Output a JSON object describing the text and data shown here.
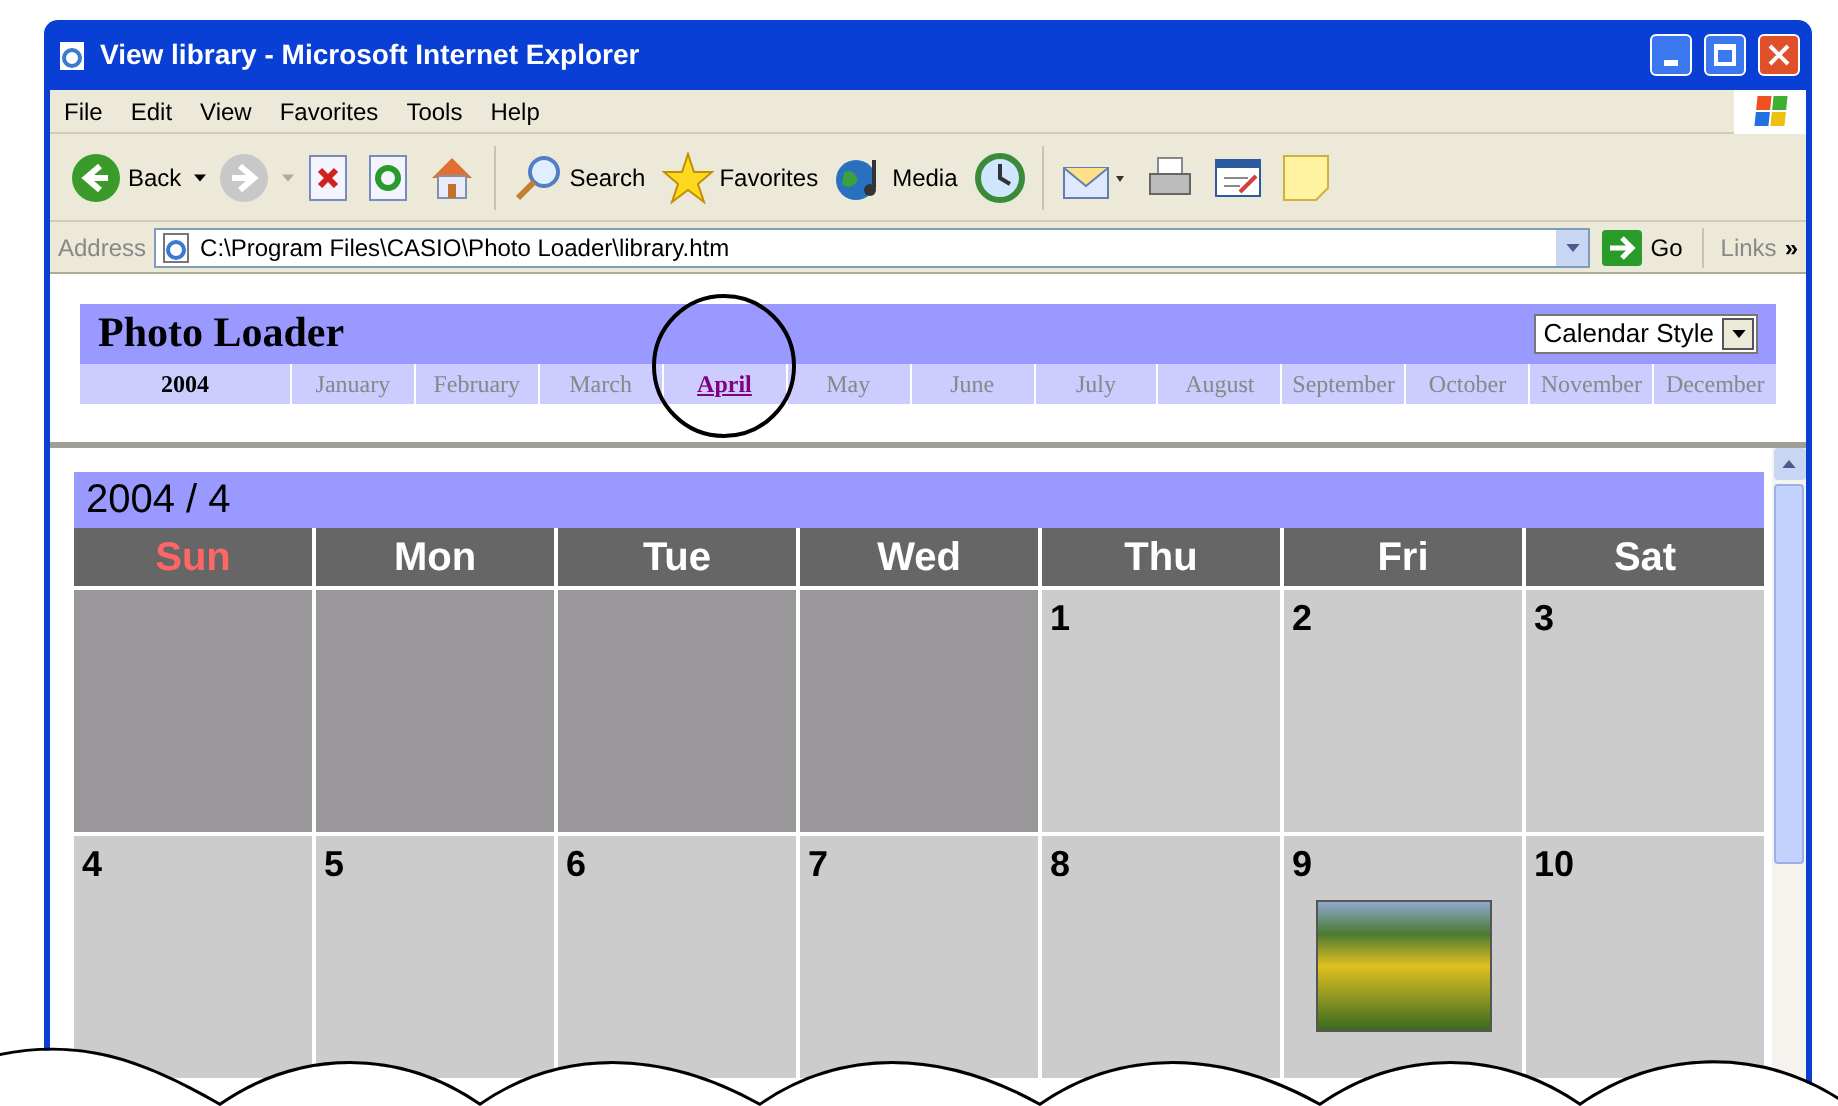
{
  "window": {
    "title": "View library - Microsoft Internet Explorer"
  },
  "menu": [
    "File",
    "Edit",
    "View",
    "Favorites",
    "Tools",
    "Help"
  ],
  "toolbar": [
    {
      "kind": "back",
      "label": "Back"
    },
    {
      "kind": "forward"
    },
    {
      "kind": "stop"
    },
    {
      "kind": "refresh"
    },
    {
      "kind": "home"
    },
    {
      "kind": "search",
      "label": "Search"
    },
    {
      "kind": "favorites",
      "label": "Favorites"
    },
    {
      "kind": "media",
      "label": "Media"
    },
    {
      "kind": "history"
    },
    {
      "kind": "mail"
    },
    {
      "kind": "print"
    },
    {
      "kind": "edit"
    },
    {
      "kind": "note"
    }
  ],
  "address_bar": {
    "label": "Address",
    "value": "C:\\Program Files\\CASIO\\Photo Loader\\library.htm",
    "go": "Go",
    "links": "Links",
    "more": "»"
  },
  "header": {
    "title": "Photo Loader",
    "style_select": "Calendar Style",
    "year": "2004",
    "months": [
      {
        "label": "January",
        "selected": false
      },
      {
        "label": "February",
        "selected": false
      },
      {
        "label": "March",
        "selected": false
      },
      {
        "label": "April",
        "selected": true
      },
      {
        "label": "May",
        "selected": false
      },
      {
        "label": "June",
        "selected": false
      },
      {
        "label": "July",
        "selected": false
      },
      {
        "label": "August",
        "selected": false
      },
      {
        "label": "September",
        "selected": false
      },
      {
        "label": "October",
        "selected": false
      },
      {
        "label": "November",
        "selected": false
      },
      {
        "label": "December",
        "selected": false
      }
    ]
  },
  "calendar": {
    "title": "2004 / 4",
    "weekdays": [
      {
        "label": "Sun",
        "holiday": true
      },
      {
        "label": "Mon",
        "holiday": false
      },
      {
        "label": "Tue",
        "holiday": false
      },
      {
        "label": "Wed",
        "holiday": false
      },
      {
        "label": "Thu",
        "holiday": false
      },
      {
        "label": "Fri",
        "holiday": false
      },
      {
        "label": "Sat",
        "holiday": false
      }
    ],
    "weeks": [
      [
        {
          "kind": "empty"
        },
        {
          "kind": "empty"
        },
        {
          "kind": "empty"
        },
        {
          "kind": "empty"
        },
        {
          "kind": "day",
          "day": "1",
          "photo": false
        },
        {
          "kind": "day",
          "day": "2",
          "photo": false
        },
        {
          "kind": "day",
          "day": "3",
          "photo": false
        }
      ],
      [
        {
          "kind": "day",
          "day": "4",
          "photo": false
        },
        {
          "kind": "day",
          "day": "5",
          "photo": false
        },
        {
          "kind": "day",
          "day": "6",
          "photo": false
        },
        {
          "kind": "day",
          "day": "7",
          "photo": false
        },
        {
          "kind": "day",
          "day": "8",
          "photo": false
        },
        {
          "kind": "day",
          "day": "9",
          "photo": true
        },
        {
          "kind": "day",
          "day": "10",
          "photo": false
        }
      ]
    ]
  }
}
